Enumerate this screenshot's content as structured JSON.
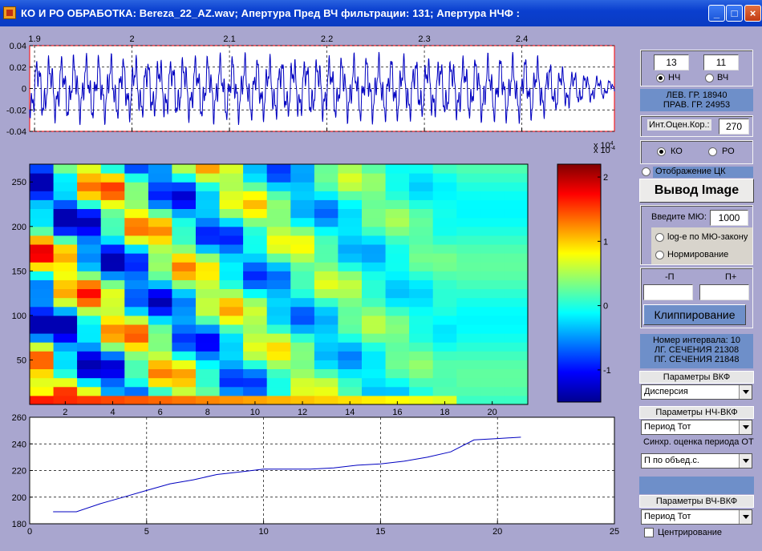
{
  "window": {
    "title": "КО И РО ОБРАБОТКА: Bereza_22_AZ.wav;  Апертура Пред ВЧ фильтрации: 131;  Апертура НЧФ :",
    "buttons": {
      "minimize": "_",
      "maximize": "□",
      "close": "×"
    }
  },
  "colors": {
    "figure_bg": "#a9a6cf",
    "plot_line": "#0000c0",
    "axes_frame": "#ff0000",
    "info_bg": "#6e8fc9"
  },
  "chart_data": [
    {
      "type": "line",
      "name": "waveform",
      "x_ticks": [
        "1.9",
        "2",
        "2.1",
        "2.2",
        "2.3",
        "2.4"
      ],
      "x_tick_values": [
        1.9,
        2.0,
        2.1,
        2.2,
        2.3,
        2.4
      ],
      "xlim": [
        1.895,
        2.495
      ],
      "y_ticks": [
        "0.04",
        "0.02",
        "0",
        "-0.02",
        "-0.04"
      ],
      "y_tick_values": [
        0.04,
        0.02,
        0,
        -0.02,
        -0.04
      ],
      "ylim": [
        -0.04,
        0.04
      ],
      "grid": true
    },
    {
      "type": "heatmap",
      "name": "correlation-map",
      "x_ticks": [
        "2",
        "4",
        "6",
        "8",
        "10",
        "12",
        "14",
        "16",
        "18",
        "20"
      ],
      "x_tick_values": [
        2,
        4,
        6,
        8,
        10,
        12,
        14,
        16,
        18,
        20
      ],
      "xlim": [
        0.5,
        21.5
      ],
      "y_ticks": [
        "250",
        "200",
        "150",
        "100",
        "50"
      ],
      "y_tick_values": [
        250,
        200,
        150,
        100,
        50
      ],
      "ylim": [
        0,
        270
      ],
      "colorbar": {
        "ticks": [
          "2",
          "1",
          "0",
          "-1"
        ],
        "tick_values": [
          2,
          1,
          0,
          -1
        ],
        "exponent_label": "x 10",
        "exponent_sup": "-4",
        "exponent_label_2": "x 10",
        "exponent_sup_2": "4",
        "range": [
          -1.5,
          2.2
        ]
      }
    },
    {
      "type": "line",
      "name": "period-curve",
      "x": [
        1,
        2,
        3,
        4,
        5,
        6,
        7,
        8,
        9,
        10,
        11,
        12,
        13,
        14,
        15,
        16,
        17,
        18,
        19,
        20,
        21
      ],
      "y": [
        189,
        189,
        195,
        200,
        205,
        210,
        213,
        217,
        219,
        221,
        221,
        221,
        222,
        224,
        225,
        227,
        230,
        234,
        243,
        244,
        245
      ],
      "x_ticks": [
        "0",
        "5",
        "10",
        "15",
        "20",
        "25"
      ],
      "x_tick_values": [
        0,
        5,
        10,
        15,
        20,
        25
      ],
      "xlim": [
        0,
        25
      ],
      "y_ticks": [
        "260",
        "240",
        "220",
        "200",
        "180"
      ],
      "y_tick_values": [
        260,
        240,
        220,
        200,
        180
      ],
      "ylim": [
        180,
        260
      ],
      "grid": true
    }
  ],
  "panel": {
    "filter": {
      "nch_value": "13",
      "vch_value": "11",
      "nch_label": "НЧ",
      "vch_label": "ВЧ",
      "selected": "НЧ"
    },
    "borders": {
      "left": "ЛЕВ. ГР.  18940",
      "right": "ПРАВ. ГР.  24953"
    },
    "int_corr": {
      "label": "Инт.Оцен.Кор.:",
      "value": "270"
    },
    "mode": {
      "ko_label": "КО",
      "ro_label": "РО",
      "selected": "КО"
    },
    "show_ck_label": "Отображение ЦК",
    "output_image_button": "Вывод Image",
    "mu": {
      "label": "Введите МЮ:",
      "value": "1000",
      "log_label": "log-е по МЮ-закону",
      "norm_label": "Нормирование"
    },
    "clip": {
      "minus_label": "-П",
      "plus_label": "П+",
      "minus_value": "",
      "plus_value": "",
      "button": "Клиппирование"
    },
    "interval": {
      "line1": "Номер интервала: 10",
      "line2": "ЛГ. СЕЧЕНИЯ 21308",
      "line3": "ПГ. СЕЧЕНИЯ 21848"
    },
    "vkf": {
      "header": "Параметры ВКФ",
      "value": "Дисперсия"
    },
    "nch_vkf": {
      "header": "Параметры НЧ-ВКФ",
      "value": "Период Тот",
      "sync_label": "Синхр. оценка периода ОТ",
      "sync_value": "П по объед.с."
    },
    "vch_vkf": {
      "header": "Параметры ВЧ-ВКФ",
      "value": "Период Тот",
      "center_label": "Центрирование"
    }
  }
}
